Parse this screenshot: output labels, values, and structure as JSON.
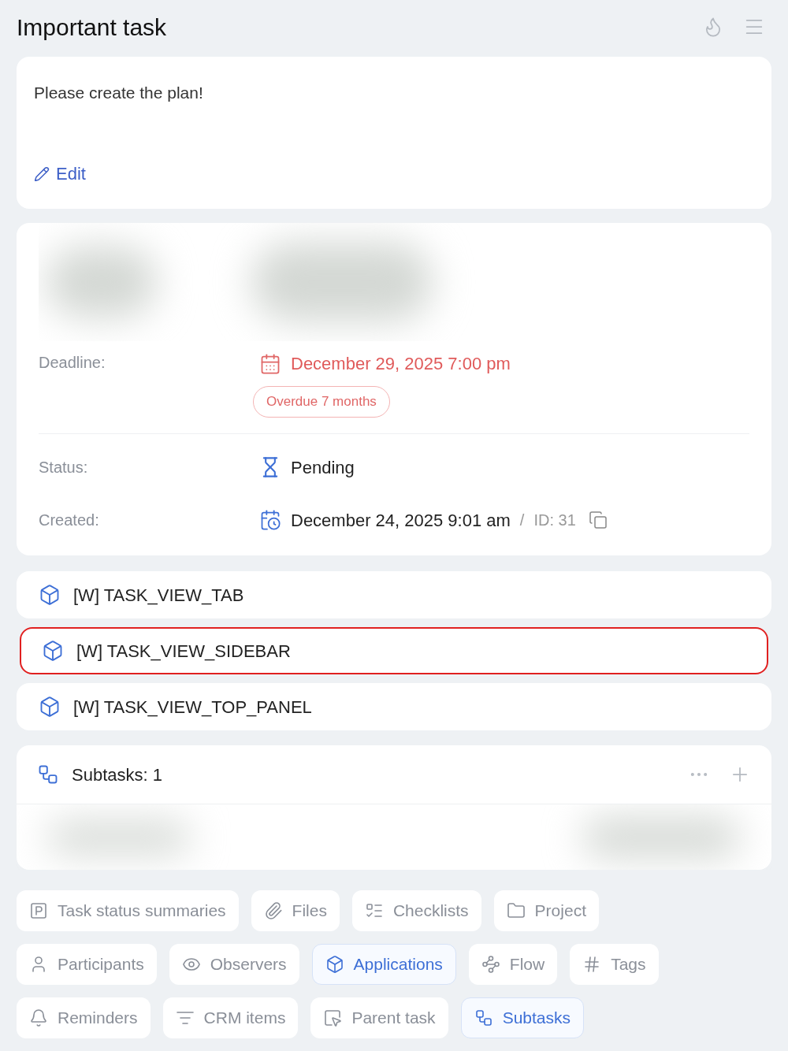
{
  "header": {
    "title": "Important task"
  },
  "description": {
    "text": "Please create the plan!",
    "edit_link": "Edit"
  },
  "details": {
    "deadline": {
      "label": "Deadline:",
      "value": "December 29, 2025 7:00 pm",
      "badge": "Overdue 7 months"
    },
    "status": {
      "label": "Status:",
      "value": "Pending"
    },
    "created": {
      "label": "Created:",
      "value": "December 24, 2025 9:01 am",
      "separator": "/",
      "id": "ID: 31"
    }
  },
  "applications": [
    {
      "label": "[W] TASK_VIEW_TAB",
      "highlighted": false
    },
    {
      "label": "[W] TASK_VIEW_SIDEBAR",
      "highlighted": true
    },
    {
      "label": "[W] TASK_VIEW_TOP_PANEL",
      "highlighted": false
    }
  ],
  "subtasks": {
    "title": "Subtasks: 1"
  },
  "chip_rows": [
    [
      {
        "label": "Task status summaries",
        "selected": false
      },
      {
        "label": "Files",
        "selected": false
      },
      {
        "label": "Checklists",
        "selected": false
      },
      {
        "label": "Project",
        "selected": false
      }
    ],
    [
      {
        "label": "Participants",
        "selected": false
      },
      {
        "label": "Observers",
        "selected": false
      },
      {
        "label": "Applications",
        "selected": true
      },
      {
        "label": "Flow",
        "selected": false
      },
      {
        "label": "Tags",
        "selected": false
      }
    ],
    [
      {
        "label": "Reminders",
        "selected": false
      },
      {
        "label": "CRM items",
        "selected": false
      },
      {
        "label": "Parent task",
        "selected": false
      },
      {
        "label": "Subtasks",
        "selected": true
      }
    ]
  ]
}
